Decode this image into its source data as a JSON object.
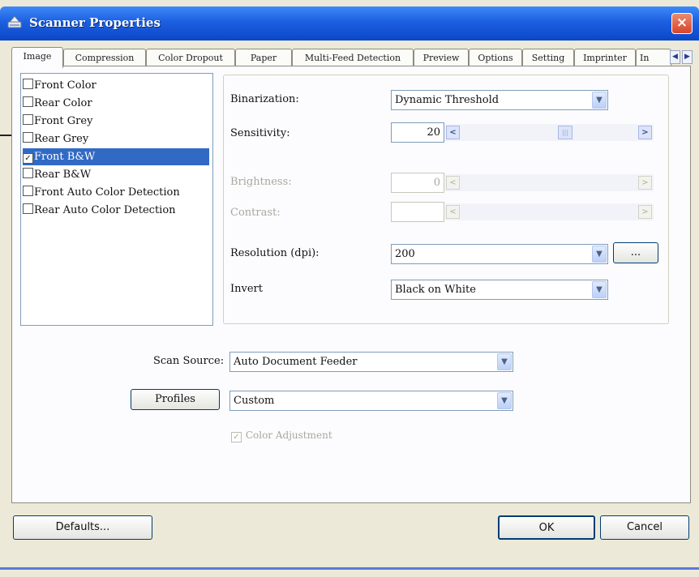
{
  "window": {
    "title": "Scanner Properties",
    "close_glyph": "×"
  },
  "tabs": [
    {
      "label": "Image",
      "active": true
    },
    {
      "label": "Compression"
    },
    {
      "label": "Color Dropout"
    },
    {
      "label": "Paper"
    },
    {
      "label": "Multi-Feed Detection"
    },
    {
      "label": "Preview"
    },
    {
      "label": "Options"
    },
    {
      "label": "Setting"
    },
    {
      "label": "Imprinter"
    },
    {
      "label": "In"
    }
  ],
  "tab_scroll": {
    "left": "◀",
    "right": "▶"
  },
  "image_list": [
    {
      "label": "Front Color",
      "checked": false
    },
    {
      "label": "Rear Color",
      "checked": false
    },
    {
      "label": "Front Grey",
      "checked": false
    },
    {
      "label": "Rear Grey",
      "checked": false
    },
    {
      "label": "Front B&W",
      "checked": true,
      "selected": true,
      "check_glyph": "✓"
    },
    {
      "label": "Rear B&W",
      "checked": false
    },
    {
      "label": "Front Auto Color Detection",
      "checked": false
    },
    {
      "label": "Rear Auto Color Detection",
      "checked": false
    }
  ],
  "settings": {
    "binarization": {
      "label": "Binarization:",
      "value": "Dynamic Threshold"
    },
    "sensitivity": {
      "label": "Sensitivity:",
      "value": "20",
      "level": 0.6
    },
    "brightness": {
      "label": "Brightness:",
      "value": "0"
    },
    "contrast": {
      "label": "Contrast:",
      "value": ""
    },
    "resolution": {
      "label": "Resolution (dpi):",
      "value": "200",
      "more_label": "..."
    },
    "invert": {
      "label": "Invert",
      "value": "Black on White"
    }
  },
  "scan_source": {
    "label": "Scan Source:",
    "value": "Auto Document Feeder"
  },
  "profiles": {
    "button_label": "Profiles",
    "value": "Custom"
  },
  "color_adjustment": {
    "label": "Color Adjustment",
    "checked": true,
    "enabled": false,
    "check_glyph": "✓"
  },
  "footer": {
    "defaults_label": "Defaults...",
    "ok_label": "OK",
    "cancel_label": "Cancel"
  },
  "glyphs": {
    "dropdown": "▼",
    "slider_left": "<",
    "slider_right": ">",
    "slider_thumb": "|||"
  },
  "colors": {
    "title_bar": "#0b47c7",
    "selection": "#316ac5",
    "dialog_bg": "#ece9d8",
    "close_button": "#d8442a"
  }
}
